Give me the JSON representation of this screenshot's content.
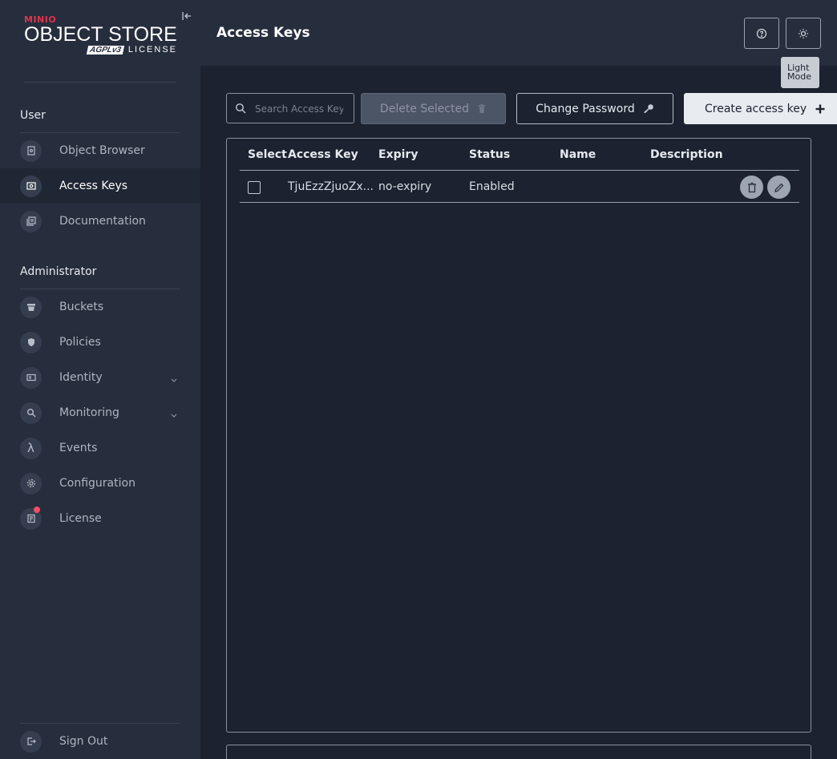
{
  "brand": {
    "minio": "MINIO",
    "object_store": "OBJECT STORE",
    "agpl": "AGPLv3",
    "license_word": "LICENSE"
  },
  "sidebar": {
    "user_section": "User",
    "user_items": [
      {
        "label": "Object Browser",
        "icon": "object-browser-icon"
      },
      {
        "label": "Access Keys",
        "icon": "access-keys-icon",
        "active": true
      },
      {
        "label": "Documentation",
        "icon": "documentation-icon"
      }
    ],
    "admin_section": "Administrator",
    "admin_items": [
      {
        "label": "Buckets",
        "icon": "bucket-icon"
      },
      {
        "label": "Policies",
        "icon": "policy-icon"
      },
      {
        "label": "Identity",
        "icon": "identity-icon",
        "expandable": true
      },
      {
        "label": "Monitoring",
        "icon": "monitoring-icon",
        "expandable": true
      },
      {
        "label": "Events",
        "icon": "lambda-icon"
      },
      {
        "label": "Configuration",
        "icon": "gear-icon"
      },
      {
        "label": "License",
        "icon": "license-icon",
        "badge": true
      }
    ],
    "sign_out": "Sign Out"
  },
  "header": {
    "title": "Access Keys",
    "tooltip": "Light Mode"
  },
  "toolbar": {
    "search_placeholder": "Search Access Keys",
    "delete_label": "Delete Selected",
    "change_password_label": "Change Password",
    "create_label": "Create access key"
  },
  "table": {
    "columns": [
      "Select",
      "Access Key",
      "Expiry",
      "Status",
      "Name",
      "Description"
    ],
    "rows": [
      {
        "access_key": "TjuEzzZjuoZx...",
        "expiry": "no-expiry",
        "status": "Enabled",
        "name": "",
        "description": ""
      }
    ]
  },
  "colors": {
    "sidebar_bg": "#262e3d",
    "main_bg": "#1c2230",
    "brand_red": "#e2334d"
  }
}
